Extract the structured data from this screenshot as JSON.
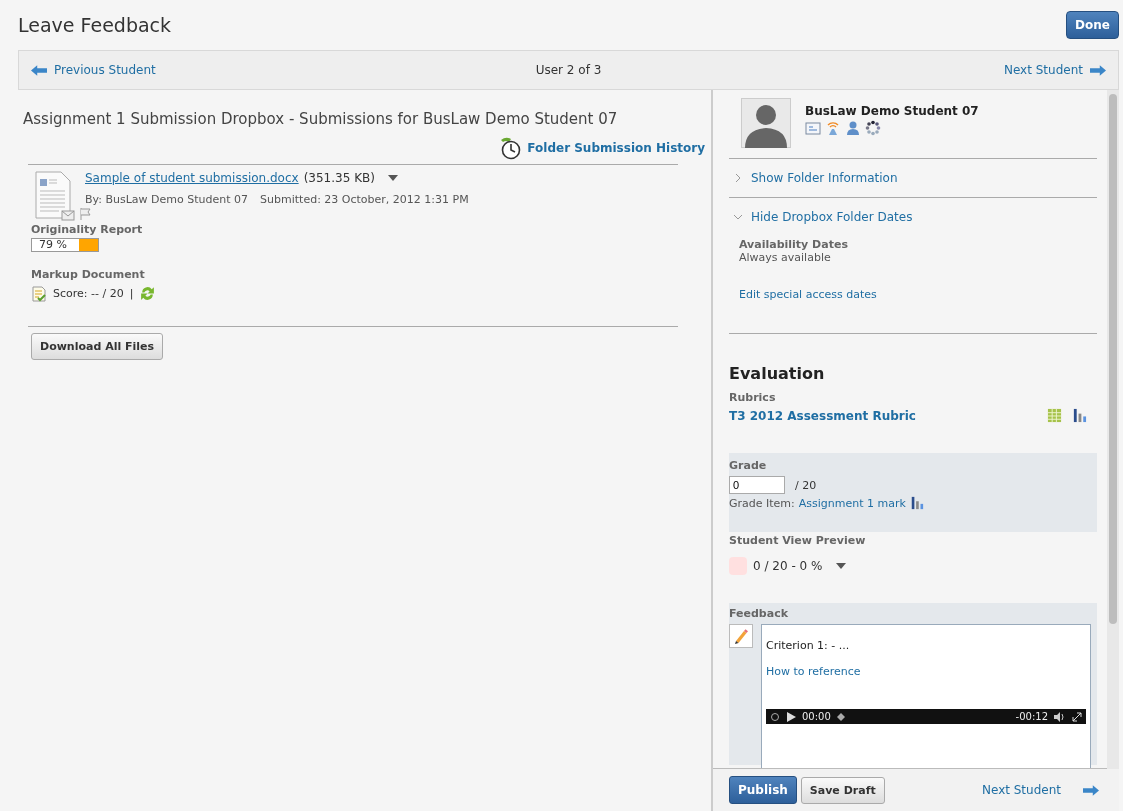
{
  "title": "Leave Feedback",
  "done_button": "Done",
  "nav": {
    "previous": "Previous Student",
    "position": "User 2 of 3",
    "next": "Next Student"
  },
  "submission": {
    "heading": "Assignment 1 Submission Dropbox - Submissions for BusLaw Demo Student 07",
    "history_link": "Folder Submission History",
    "file": {
      "name": "Sample of student submission.docx",
      "size": "(351.35 KB)",
      "by": "By: BusLaw Demo Student 07",
      "submitted": "Submitted: 23 October, 2012 1:31 PM"
    },
    "originality": {
      "label": "Originality Report",
      "value": "79 %"
    },
    "markup": {
      "label": "Markup Document",
      "score": "Score: -- / 20",
      "separator": "|"
    },
    "download_button": "Download All Files"
  },
  "student": {
    "name": "BusLaw Demo Student 07"
  },
  "folder_info": {
    "label": "Show Folder Information",
    "expanded": false
  },
  "folder_dates": {
    "label": "Hide Dropbox Folder Dates",
    "expanded": true,
    "heading": "Availability Dates",
    "value": "Always available",
    "link": "Edit special access dates"
  },
  "evaluation": {
    "title": "Evaluation",
    "rubrics_label": "Rubrics",
    "rubric": "T3 2012 Assessment Rubric",
    "grade_label": "Grade",
    "grade_value": "0",
    "grade_max": "/ 20",
    "grade_item_label": "Grade Item:",
    "grade_item": "Assignment 1 mark",
    "preview_label": "Student View Preview",
    "preview_value": "0 / 20 - 0 %",
    "feedback_label": "Feedback",
    "feedback_text": "Criterion 1: - ...",
    "feedback_link": "How to reference",
    "player": {
      "elapsed": "00:00",
      "remaining": "-00:12"
    }
  },
  "footer": {
    "publish": "Publish",
    "save_draft": "Save Draft",
    "next": "Next Student"
  }
}
